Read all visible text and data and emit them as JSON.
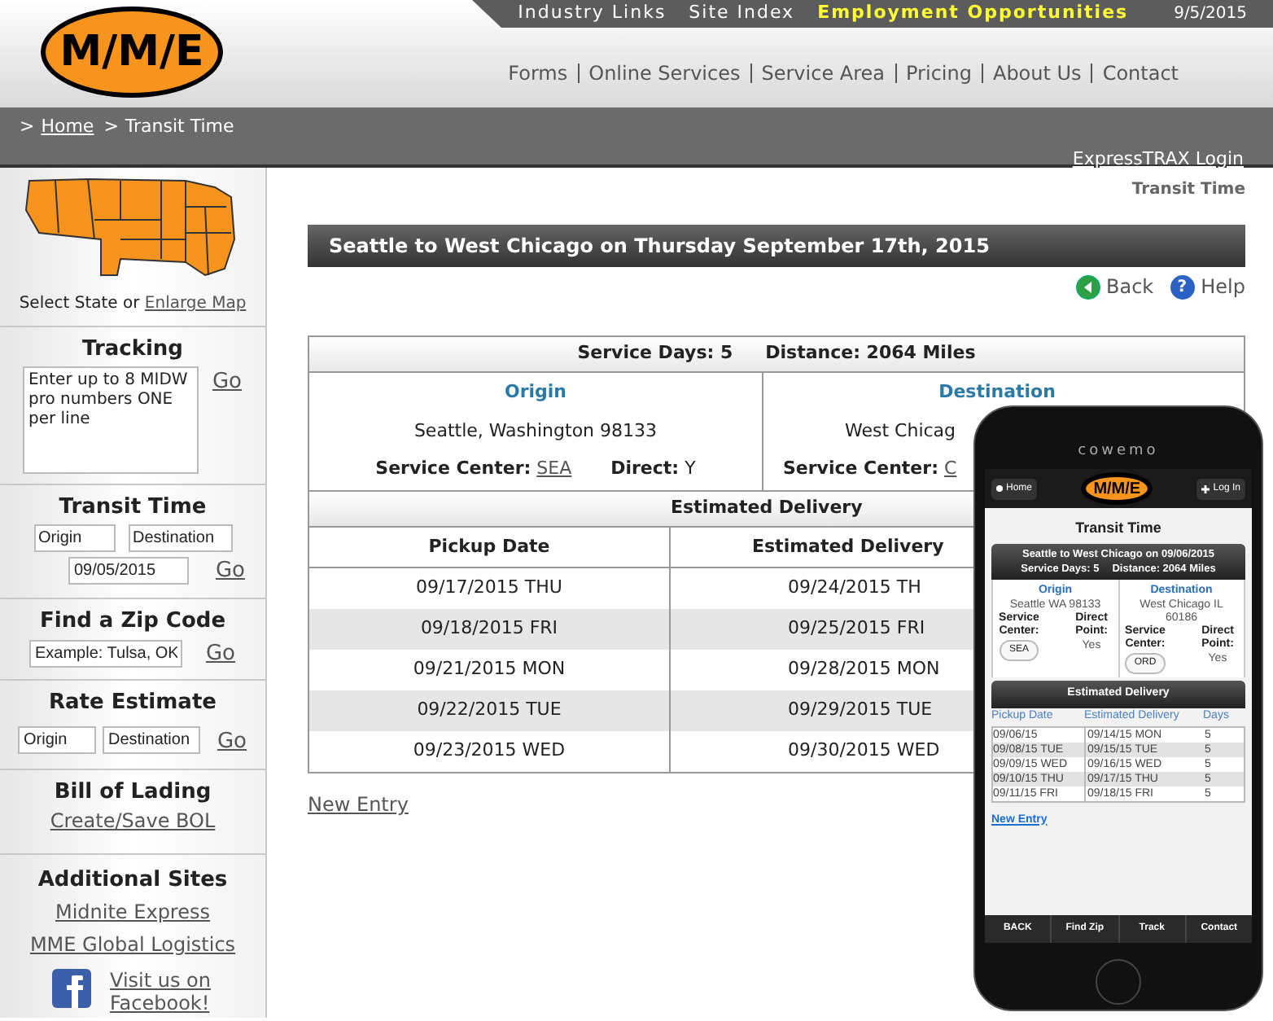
{
  "logo": {
    "text": "M/M/E"
  },
  "top_links": [
    {
      "label": "Industry Links",
      "highlight": false
    },
    {
      "label": "Site Index",
      "highlight": false
    },
    {
      "label": "Employment Opportunities",
      "highlight": true
    }
  ],
  "date": "9/5/2015",
  "nav": [
    "Forms",
    "Online Services",
    "Service Area",
    "Pricing",
    "About Us",
    "Contact"
  ],
  "breadcrumb": [
    {
      "separator": ">",
      "label": "Home",
      "link": true
    },
    {
      "separator": ">",
      "label": "Transit Time",
      "link": false
    }
  ],
  "login_link": "ExpressTRAX Login",
  "sidebar": {
    "map": {
      "caption": "Select State or",
      "link": "Enlarge Map"
    },
    "tracking": {
      "title": "Tracking",
      "value": "Enter up to 8 MIDW pro numbers ONE per line",
      "go": "Go"
    },
    "transit": {
      "title": "Transit Time",
      "origin": "Origin",
      "destination": "Destination",
      "date": "09/05/2015",
      "go": "Go"
    },
    "zip": {
      "title": "Find a Zip Code",
      "value": "Example: Tulsa, OK",
      "go": "Go"
    },
    "rate": {
      "title": "Rate Estimate",
      "origin": "Origin",
      "destination": "Destination",
      "go": "Go"
    },
    "bol": {
      "title": "Bill of Lading",
      "link": "Create/Save BOL"
    },
    "sites": {
      "title": "Additional Sites",
      "links": [
        "Midnite Express",
        "MME Global Logistics"
      ],
      "facebook": "Visit us on Facebook!"
    }
  },
  "page_title": "Transit Time",
  "heading": "Seattle to West Chicago on Thursday September 17th, 2015",
  "actions": [
    {
      "kind": "back",
      "label": "Back"
    },
    {
      "kind": "help",
      "label": "Help",
      "icon": "?"
    }
  ],
  "summary": [
    "Service Days: 5",
    "Distance: 2064 Miles"
  ],
  "origin": {
    "heading": "Origin",
    "address": "Seattle, Washington 98133",
    "service_center_label": "Service Center:",
    "service_center": "SEA",
    "direct_label": "Direct:",
    "direct": "Y"
  },
  "destination": {
    "heading": "Destination",
    "address": "West Chicag",
    "service_center_label": "Service Center:",
    "service_center": "C"
  },
  "delivery": {
    "heading": "Estimated Delivery",
    "columns": [
      "Pickup Date",
      "Estimated Delivery"
    ],
    "rows": [
      [
        "09/17/2015 THU",
        "09/24/2015 TH"
      ],
      [
        "09/18/2015 FRI",
        "09/25/2015 FRI"
      ],
      [
        "09/21/2015 MON",
        "09/28/2015 MON"
      ],
      [
        "09/22/2015 TUE",
        "09/29/2015 TUE"
      ],
      [
        "09/23/2015 WED",
        "09/30/2015 WED"
      ]
    ]
  },
  "new_entry": "New Entry",
  "phone": {
    "brand": "cowemo",
    "home": "Home",
    "login": "Log In",
    "logo": "M/M/E",
    "title": "Transit Time",
    "heading": "Seattle to West Chicago on 09/06/2015",
    "summary": [
      "Service Days: 5",
      "Distance: 2064 Miles"
    ],
    "ends": [
      {
        "heading": "Origin",
        "address": "Seattle WA 98133",
        "center_label": "Service Center:",
        "center": "SEA",
        "direct_label": "Direct Point:",
        "direct": "Yes"
      },
      {
        "heading": "Destination",
        "address": "West Chicago IL 60186",
        "center_label": "Service Center:",
        "center": "ORD",
        "direct_label": "Direct Point:",
        "direct": "Yes"
      }
    ],
    "delivery_heading": "Estimated Delivery",
    "columns": [
      "Pickup Date",
      "Estimated Delivery",
      "Days"
    ],
    "rows": [
      [
        "09/06/15",
        "09/14/15 MON",
        "5"
      ],
      [
        "09/08/15 TUE",
        "09/15/15 TUE",
        "5"
      ],
      [
        "09/09/15 WED",
        "09/16/15 WED",
        "5"
      ],
      [
        "09/10/15 THU",
        "09/17/15 THU",
        "5"
      ],
      [
        "09/11/15 FRI",
        "09/18/15 FRI",
        "5"
      ]
    ],
    "new_entry": "New Entry",
    "tabs": [
      "BACK",
      "Find Zip",
      "Track",
      "Contact"
    ]
  }
}
